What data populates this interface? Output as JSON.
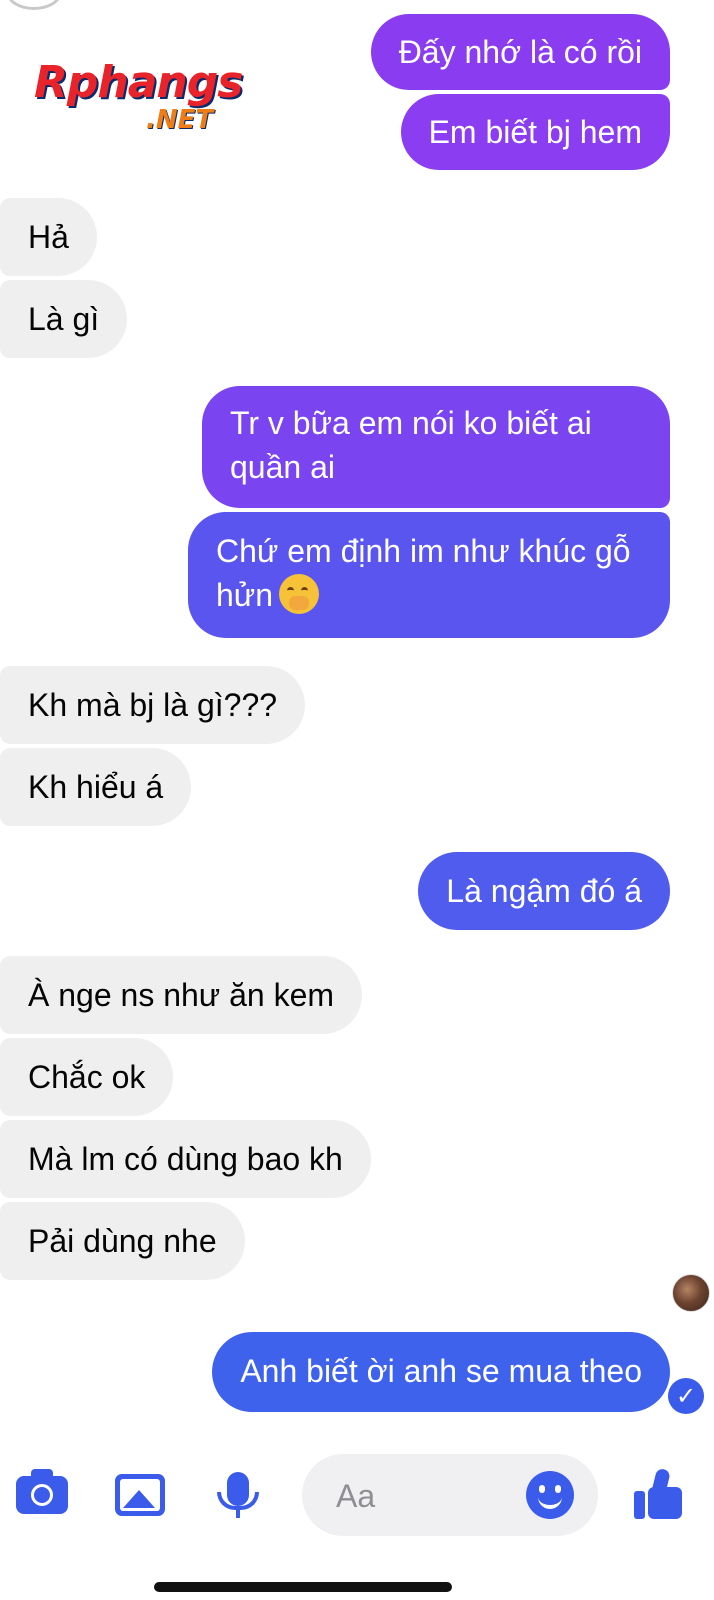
{
  "logo": {
    "brand": "Rphangs",
    "suffix": ".NET"
  },
  "messages": [
    {
      "dir": "out",
      "text": "Đấy nhớ là có rồi"
    },
    {
      "dir": "out",
      "text": "Em biết bj hem"
    },
    {
      "dir": "in",
      "text": "Hả"
    },
    {
      "dir": "in",
      "text": "Là gì"
    },
    {
      "dir": "out",
      "text": "Tr v bữa em nói ko biết ai quần ai"
    },
    {
      "dir": "out",
      "text": "Chứ em định im như khúc gỗ hửn",
      "emoji": "shushing-face"
    },
    {
      "dir": "in",
      "text": "Kh mà bj là gì???"
    },
    {
      "dir": "in",
      "text": "Kh hiểu á"
    },
    {
      "dir": "out",
      "text": "Là ngậm đó á"
    },
    {
      "dir": "in",
      "text": "À nge ns như ăn kem"
    },
    {
      "dir": "in",
      "text": "Chắc ok"
    },
    {
      "dir": "in",
      "text": "Mà lm có dùng bao kh"
    },
    {
      "dir": "in",
      "text": "Pải dùng nhe"
    },
    {
      "dir": "out",
      "text": "Anh biết ời anh se mua theo"
    }
  ],
  "composer": {
    "placeholder": "Aa",
    "icons": [
      "camera-icon",
      "photo-icon",
      "microphone-icon",
      "emoji-icon",
      "thumbs-up-icon"
    ]
  },
  "colors": {
    "incoming_bg": "#efefef",
    "outgoing_purple": "#8b3cf1",
    "outgoing_mid": "#6a4cf0",
    "outgoing_blue": "#3f62ec",
    "accent": "#3b5bea"
  }
}
